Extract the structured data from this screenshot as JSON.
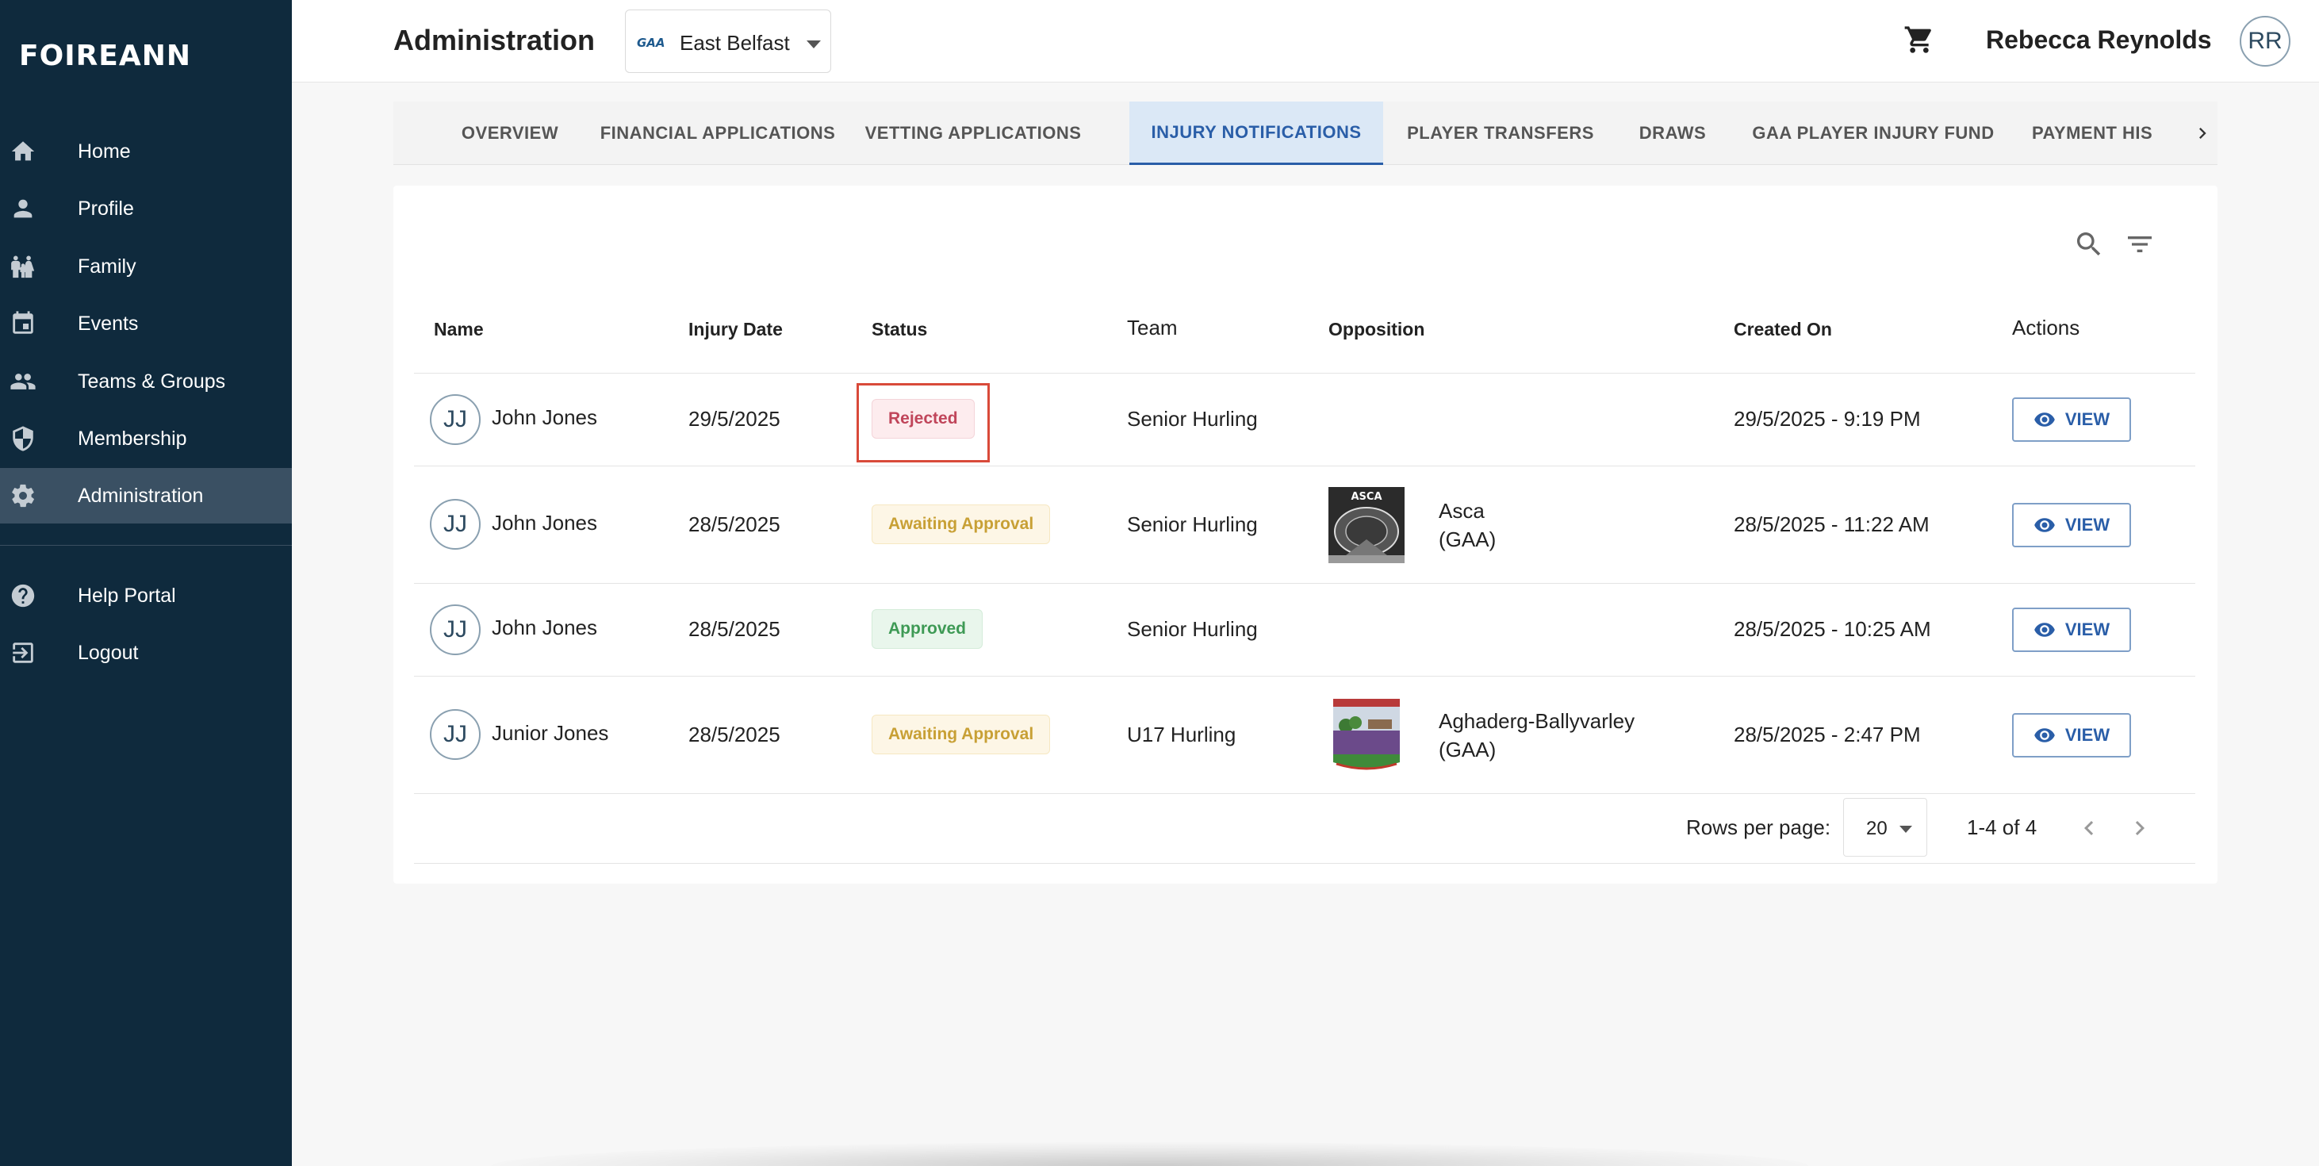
{
  "brand": {
    "logo_text": "FOIREANN"
  },
  "sidebar": {
    "items": [
      {
        "label": "Home",
        "icon": "home-icon"
      },
      {
        "label": "Profile",
        "icon": "person-icon"
      },
      {
        "label": "Family",
        "icon": "family-icon"
      },
      {
        "label": "Events",
        "icon": "calendar-icon"
      },
      {
        "label": "Teams & Groups",
        "icon": "group-icon"
      },
      {
        "label": "Membership",
        "icon": "shield-icon"
      },
      {
        "label": "Administration",
        "icon": "gear-icon",
        "active": true
      },
      {
        "label": "Help Portal",
        "icon": "help-icon"
      },
      {
        "label": "Logout",
        "icon": "logout-icon"
      }
    ]
  },
  "header": {
    "title": "Administration",
    "club_select": {
      "value": "East Belfast",
      "logo_text": "GAA"
    },
    "user_name": "Rebecca Reynolds",
    "user_initials": "RR"
  },
  "tabs": [
    {
      "label": "OVERVIEW"
    },
    {
      "label": "FINANCIAL APPLICATIONS"
    },
    {
      "label": "VETTING APPLICATIONS"
    },
    {
      "label": "INJURY NOTIFICATIONS",
      "active": true
    },
    {
      "label": "PLAYER TRANSFERS"
    },
    {
      "label": "DRAWS"
    },
    {
      "label": "GAA PLAYER INJURY FUND"
    },
    {
      "label": "PAYMENT HIS"
    }
  ],
  "table": {
    "columns": {
      "name": "Name",
      "injury_date": "Injury Date",
      "status": "Status",
      "team": "Team",
      "opposition": "Opposition",
      "created_on": "Created On",
      "actions": "Actions"
    },
    "rows": [
      {
        "initials": "JJ",
        "name": "John Jones",
        "injury_date": "29/5/2025",
        "status": "Rejected",
        "team": "Senior Hurling",
        "opposition": "",
        "opposition_sub": "",
        "created_on": "29/5/2025 - 9:19 PM",
        "action": "VIEW"
      },
      {
        "initials": "JJ",
        "name": "John Jones",
        "injury_date": "28/5/2025",
        "status": "Awaiting Approval",
        "team": "Senior Hurling",
        "opposition": "Asca",
        "opposition_sub": "(GAA)",
        "opposition_logo_text": "ASCA",
        "created_on": "28/5/2025 - 11:22 AM",
        "action": "VIEW"
      },
      {
        "initials": "JJ",
        "name": "John Jones",
        "injury_date": "28/5/2025",
        "status": "Approved",
        "team": "Senior Hurling",
        "opposition": "",
        "opposition_sub": "",
        "created_on": "28/5/2025 - 10:25 AM",
        "action": "VIEW"
      },
      {
        "initials": "JJ",
        "name": "Junior Jones",
        "injury_date": "28/5/2025",
        "status": "Awaiting Approval",
        "team": "U17 Hurling",
        "opposition": "Aghaderg-Ballyvarley",
        "opposition_sub": "(GAA)",
        "created_on": "28/5/2025 - 2:47 PM",
        "action": "VIEW"
      }
    ]
  },
  "pagination": {
    "rows_per_page_label": "Rows per page:",
    "rows_per_page_value": "20",
    "range": "1-4 of 4"
  },
  "colors": {
    "sidebar_bg": "#0f2a3d",
    "accent": "#2a5ea8",
    "rejected": "#c0455a",
    "awaiting": "#c8a035",
    "approved": "#3e9a55",
    "highlight": "#d94a3a"
  }
}
